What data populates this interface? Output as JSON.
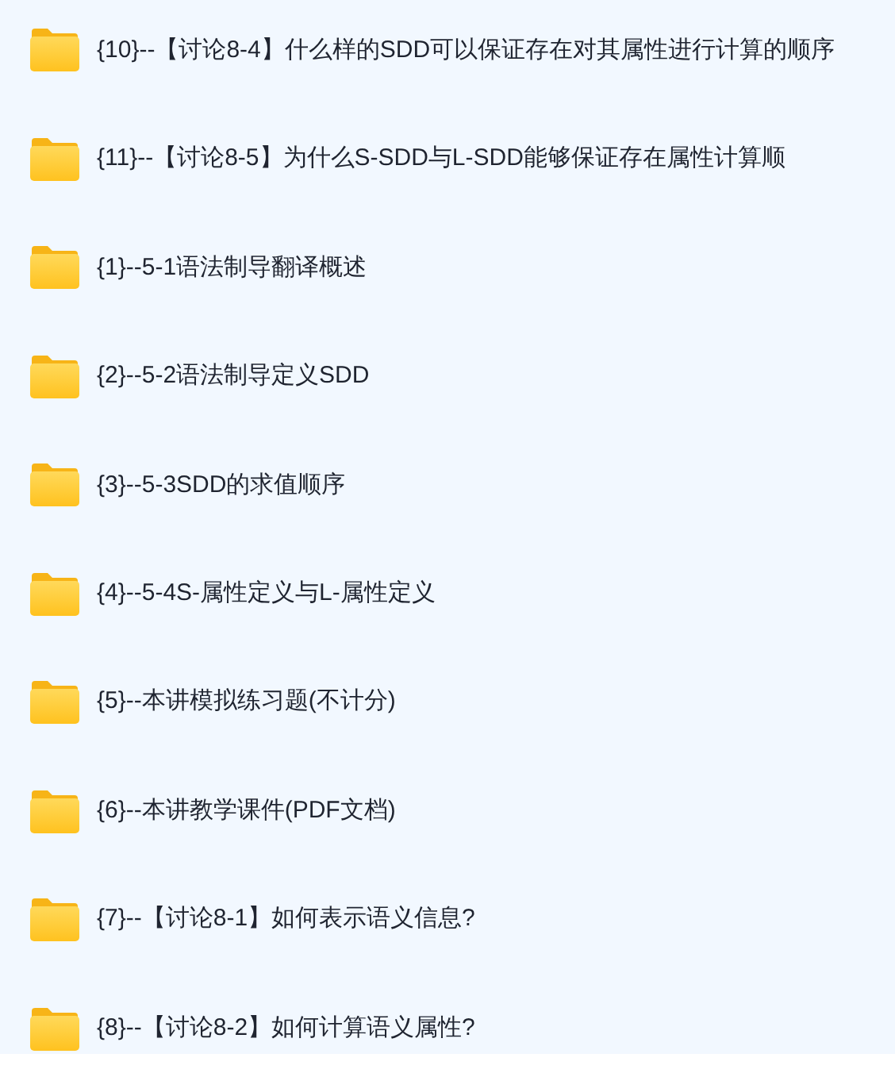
{
  "folders": [
    {
      "label": "{10}--【讨论8-4】什么样的SDD可以保证存在对其属性进行计算的顺序"
    },
    {
      "label": "{11}--【讨论8-5】为什么S-SDD与L-SDD能够保证存在属性计算顺"
    },
    {
      "label": "{1}--5-1语法制导翻译概述"
    },
    {
      "label": "{2}--5-2语法制导定义SDD"
    },
    {
      "label": "{3}--5-3SDD的求值顺序"
    },
    {
      "label": "{4}--5-4S-属性定义与L-属性定义"
    },
    {
      "label": "{5}--本讲模拟练习题(不计分)"
    },
    {
      "label": "{6}--本讲教学课件(PDF文档)"
    },
    {
      "label": "{7}--【讨论8-1】如何表示语义信息?"
    },
    {
      "label": "{8}--【讨论8-2】如何计算语义属性?"
    }
  ]
}
